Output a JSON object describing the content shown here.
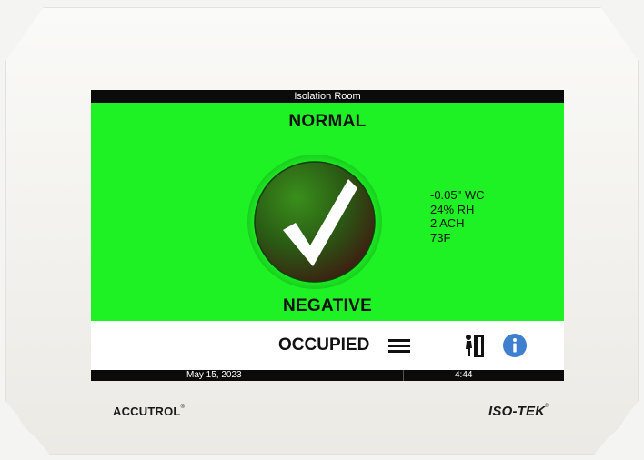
{
  "device": {
    "brand_left": "ACCUTROL",
    "brand_left_mark": "®",
    "brand_right": "ISO-TEK",
    "brand_right_mark": "®"
  },
  "screen": {
    "room_title": "Isolation Room",
    "status": "NORMAL",
    "pressure_mode": "NEGATIVE",
    "status_color": "#1ff224",
    "status_icon": "check-circle-icon",
    "readings": [
      "-0.05\" WC",
      "24% RH",
      "2 ACH",
      "73F"
    ],
    "occupancy": "OCCUPIED",
    "icons": [
      "menu-icon",
      "door-person-icon",
      "info-icon"
    ],
    "footer": {
      "date": "May 15, 2023",
      "time": "4:44"
    }
  }
}
